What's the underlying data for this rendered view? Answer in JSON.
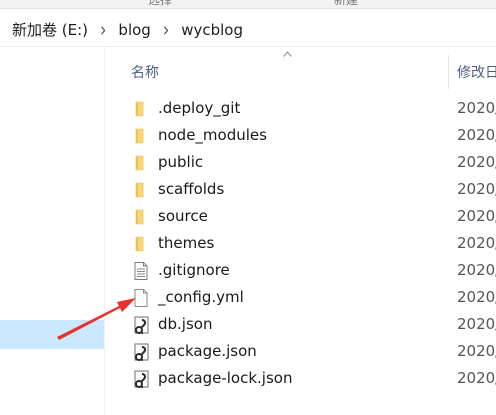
{
  "ribbon": {
    "items": [
      "选择",
      "新建"
    ]
  },
  "breadcrumb": {
    "items": [
      "新加卷 (E:)",
      "blog",
      "wycblog"
    ],
    "separator": "›"
  },
  "columns": {
    "name": "名称",
    "date": "修改日"
  },
  "files": [
    {
      "name": ".deploy_git",
      "type": "folder",
      "date": "2020/"
    },
    {
      "name": "node_modules",
      "type": "folder",
      "date": "2020/"
    },
    {
      "name": "public",
      "type": "folder",
      "date": "2020/"
    },
    {
      "name": "scaffolds",
      "type": "folder",
      "date": "2020/"
    },
    {
      "name": "source",
      "type": "folder",
      "date": "2020/"
    },
    {
      "name": "themes",
      "type": "folder",
      "date": "2020/"
    },
    {
      "name": ".gitignore",
      "type": "text-file",
      "date": "2020/"
    },
    {
      "name": "_config.yml",
      "type": "blank-file",
      "date": "2020/"
    },
    {
      "name": "db.json",
      "type": "json-file",
      "date": "2020/"
    },
    {
      "name": "package.json",
      "type": "json-file",
      "date": "2020/"
    },
    {
      "name": "package-lock.json",
      "type": "json-file",
      "date": "2020/"
    }
  ],
  "colors": {
    "folder": "#f8d775",
    "selection": "#cce8ff",
    "arrow": "#e8312b",
    "header_text": "#4d6082"
  }
}
